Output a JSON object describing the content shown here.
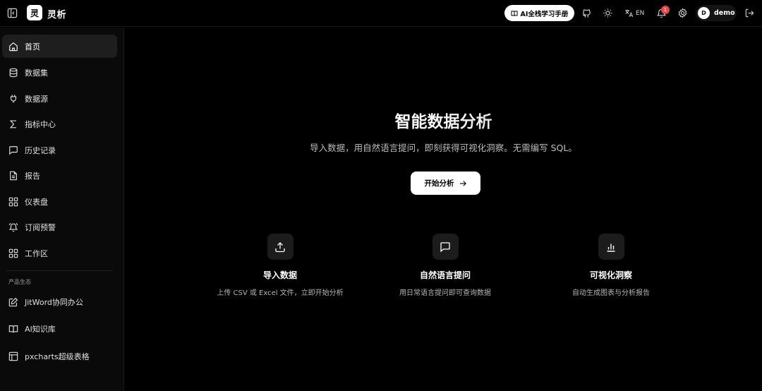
{
  "app": {
    "logo_char": "灵",
    "name": "灵析"
  },
  "topbar": {
    "manual_label": "AI全栈学习手册",
    "lang_label": "EN",
    "notification_count": "1",
    "user_initial": "D",
    "user_name": "demo",
    "icons": [
      "sidebar-collapse-icon",
      "book-icon",
      "github-icon",
      "sun-icon",
      "translate-icon",
      "bell-icon",
      "gear-icon",
      "logout-icon"
    ]
  },
  "sidebar": {
    "items": [
      {
        "label": "首页",
        "icon": "home-icon",
        "active": true
      },
      {
        "label": "数据集",
        "icon": "database-icon"
      },
      {
        "label": "数据源",
        "icon": "plug-icon"
      },
      {
        "label": "指标中心",
        "icon": "sigma-icon"
      },
      {
        "label": "历史记录",
        "icon": "message-icon"
      },
      {
        "label": "报告",
        "icon": "file-icon"
      },
      {
        "label": "仪表盘",
        "icon": "grid-icon"
      },
      {
        "label": "订阅预警",
        "icon": "bell-ring-icon"
      },
      {
        "label": "工作区",
        "icon": "grid-icon"
      }
    ],
    "section_label": "产品生态",
    "eco_items": [
      {
        "label": "JitWord协同办公",
        "icon": "edit-icon"
      },
      {
        "label": "AI知识库",
        "icon": "book-open-icon"
      },
      {
        "label": "pxcharts超级表格",
        "icon": "table-icon"
      }
    ]
  },
  "hero": {
    "title": "智能数据分析",
    "subtitle": "导入数据，用自然语言提问，即刻获得可视化洞察。无需编写 SQL。",
    "cta_label": "开始分析"
  },
  "features": [
    {
      "title": "导入数据",
      "desc": "上传 CSV 或 Excel 文件，立即开始分析",
      "icon": "upload-icon"
    },
    {
      "title": "自然语言提问",
      "desc": "用日常语言提问即可查询数据",
      "icon": "message-icon"
    },
    {
      "title": "可视化洞察",
      "desc": "自动生成图表与分析报告",
      "icon": "bar-chart-icon"
    }
  ],
  "colors": {
    "background": "#000000",
    "sidebar": "#0a0a0a",
    "badge": "#e5484d",
    "accent": "#ffffff"
  }
}
